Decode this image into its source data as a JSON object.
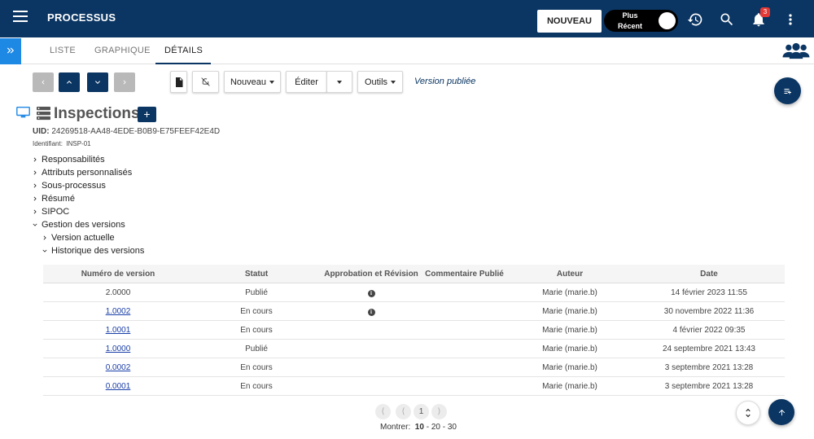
{
  "topbar": {
    "app_title": "PROCESSUS",
    "new_button": "NOUVEAU",
    "toggle_label": "Plus Récent",
    "notification_count": "3",
    "icons": [
      "menu-icon",
      "history-icon",
      "search-icon",
      "bell-icon",
      "more-vert-icon"
    ]
  },
  "tabs": [
    {
      "label": "LISTE",
      "active": false
    },
    {
      "label": "GRAPHIQUE",
      "active": false
    },
    {
      "label": "DÉTAILS",
      "active": true
    }
  ],
  "toolbar": {
    "nouveau": "Nouveau",
    "editer": "Éditer",
    "outils": "Outils",
    "status": "Version publiée"
  },
  "header": {
    "title": "Inspections",
    "uid_label": "UID:",
    "uid_value": "24269518-AA48-4EDE-B0B9-E75FEEF42E4D",
    "ident_label": "Identifiant:",
    "ident_value": "INSP-01"
  },
  "tree": [
    {
      "label": "Responsabilités",
      "expanded": false
    },
    {
      "label": "Attributs personnalisés",
      "expanded": false
    },
    {
      "label": "Sous-processus",
      "expanded": false
    },
    {
      "label": "Résumé",
      "expanded": false
    },
    {
      "label": "SIPOC",
      "expanded": false
    },
    {
      "label": "Gestion des versions",
      "expanded": true
    },
    {
      "label": "Version actuelle",
      "expanded": false
    },
    {
      "label": "Historique des versions",
      "expanded": true
    }
  ],
  "table": {
    "headers": [
      "Numéro de version",
      "Statut",
      "Approbation et Révision",
      "Commentaire Publié",
      "Auteur",
      "Date"
    ],
    "rows": [
      {
        "version": "2.0000",
        "link": false,
        "statut": "Publié",
        "info": true,
        "commentaire": "",
        "auteur": "Marie (marie.b)",
        "date": "14 février 2023 11:55"
      },
      {
        "version": "1.0002",
        "link": true,
        "statut": "En cours",
        "info": true,
        "commentaire": "",
        "auteur": "Marie (marie.b)",
        "date": "30 novembre 2022 11:36"
      },
      {
        "version": "1.0001",
        "link": true,
        "statut": "En cours",
        "info": false,
        "commentaire": "",
        "auteur": "Marie (marie.b)",
        "date": "4 février 2022 09:35"
      },
      {
        "version": "1.0000",
        "link": true,
        "statut": "Publié",
        "info": false,
        "commentaire": "",
        "auteur": "Marie (marie.b)",
        "date": "24 septembre 2021 13:43"
      },
      {
        "version": "0.0002",
        "link": true,
        "statut": "En cours",
        "info": false,
        "commentaire": "",
        "auteur": "Marie (marie.b)",
        "date": "3 septembre 2021 13:28"
      },
      {
        "version": "0.0001",
        "link": true,
        "statut": "En cours",
        "info": false,
        "commentaire": "",
        "auteur": "Marie (marie.b)",
        "date": "3 septembre 2021 13:28"
      }
    ]
  },
  "pagination": {
    "current_page": "1",
    "show_label": "Montrer:",
    "sizes": [
      "10",
      "20",
      "30"
    ],
    "selected_size": "10"
  },
  "colors": {
    "primary": "#0b3663",
    "accent": "#1e88e5",
    "badge": "#e53935"
  }
}
